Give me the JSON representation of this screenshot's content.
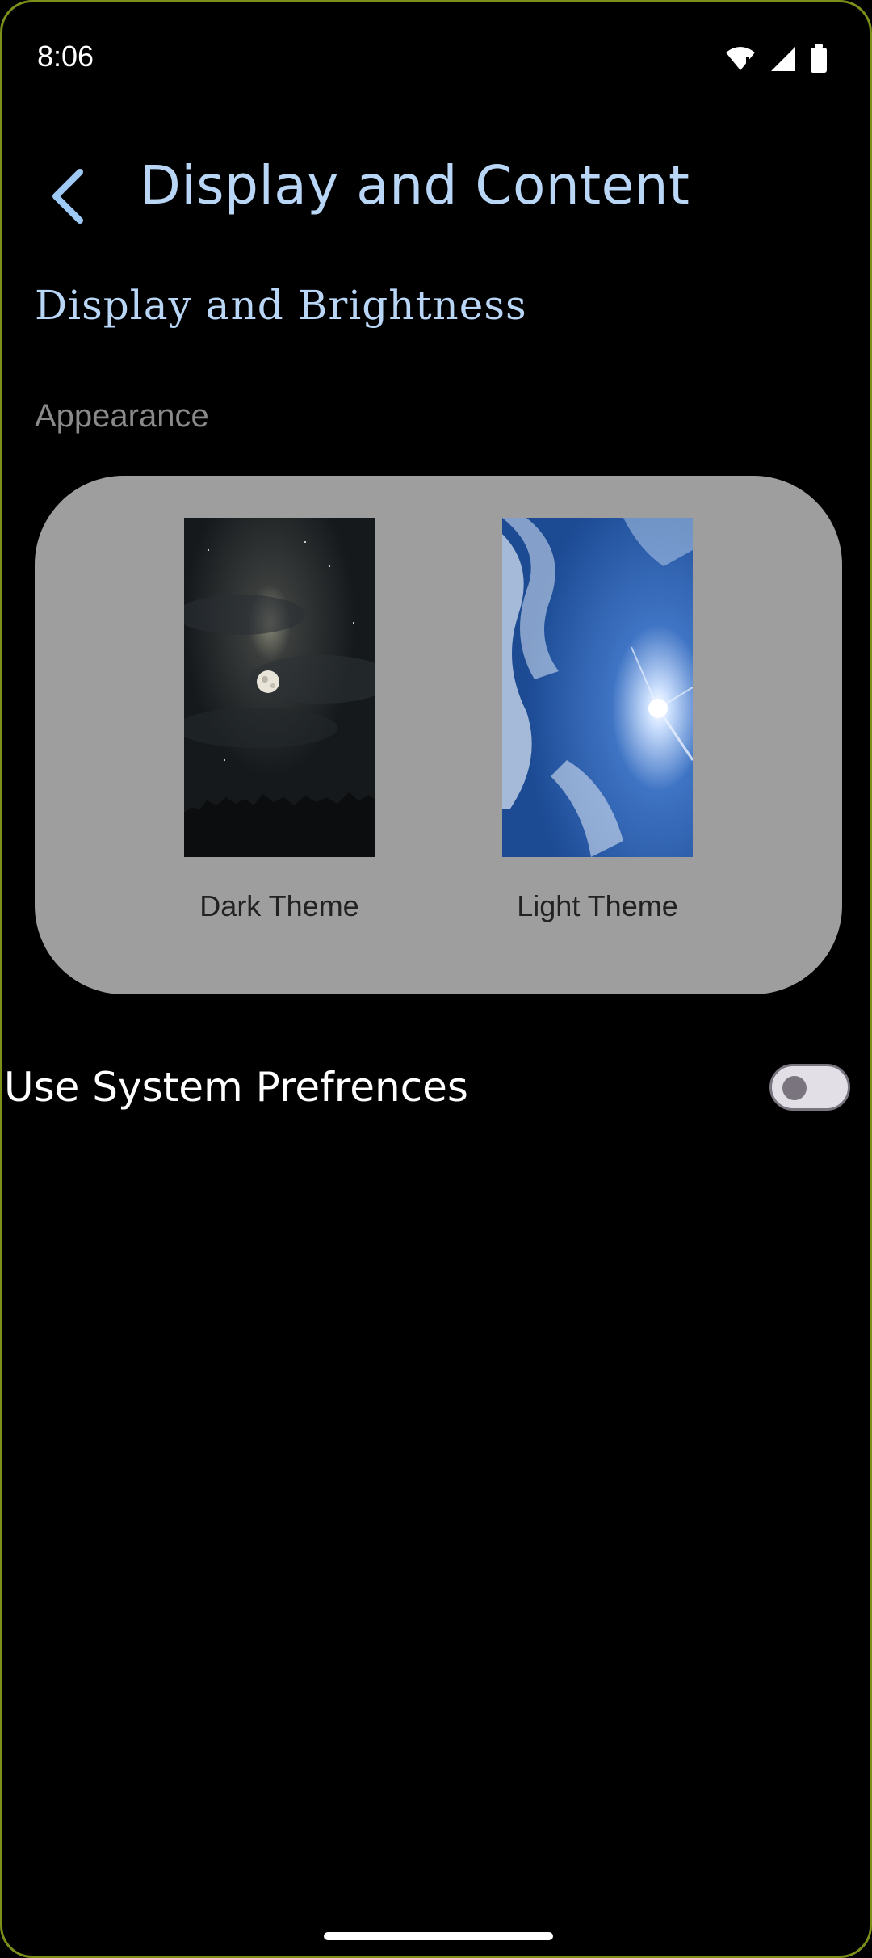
{
  "status_bar": {
    "time": "8:06",
    "icons": [
      "wifi-icon",
      "cell-signal-icon",
      "battery-icon"
    ]
  },
  "app_bar": {
    "back_icon": "chevron-left-icon",
    "title": "Display and Content"
  },
  "section": {
    "title": "Display and Brightness",
    "appearance_label": "Appearance"
  },
  "themes": {
    "dark": {
      "label": "Dark Theme",
      "image": "night-sky-moon"
    },
    "light": {
      "label": "Light Theme",
      "image": "blue-sky-sun"
    }
  },
  "preferences": {
    "use_system_label": "Use System Prefrences",
    "use_system_enabled": false
  },
  "colors": {
    "accent": "#b9d6f6",
    "card_bg": "#9e9e9e",
    "background": "#000000"
  }
}
